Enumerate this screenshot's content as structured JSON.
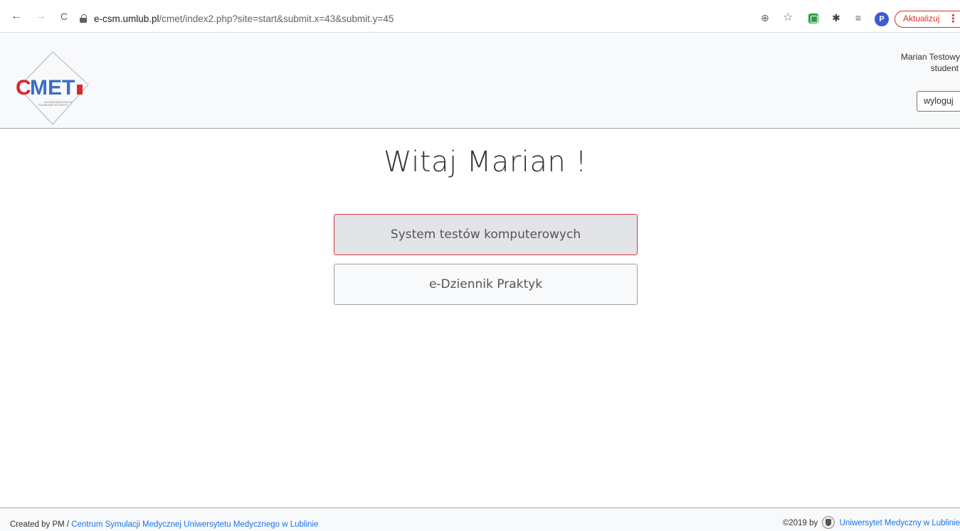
{
  "browser": {
    "back_glyph": "←",
    "forward_glyph": "→",
    "reload_glyph": "C",
    "url_host": "e-csm.umlub.pl",
    "url_path": "/cmet/index2.php?site=start&submit.x=43&submit.y=45",
    "zoom_glyph": "⊕",
    "star_glyph": "☆",
    "puzzle_glyph": "✱",
    "playlist_glyph": "≡",
    "profile_letter": "P",
    "update_label": "Aktualizuj",
    "menu_glyph": "⋮"
  },
  "header": {
    "logo_text": "CMET",
    "logo_subtitle_line1": "CENTRUM MEDYCZNYCH",
    "logo_subtitle_line2": "EGZAMINÓW TESTOWYCH",
    "user_name": "Marian Testowy",
    "user_role": "student",
    "logout_label": "wyloguj"
  },
  "main": {
    "welcome": "Witaj Marian !",
    "buttons": [
      {
        "label": "System testów komputerowych"
      },
      {
        "label": "e-Dziennik Praktyk"
      }
    ]
  },
  "footer": {
    "created_prefix": "Created by PM / ",
    "created_link": "Centrum Symulacji Medycznej Uniwersytetu Medycznego w Lublinie",
    "copyright": "©2019 by",
    "university_link": "Uniwersytet Medyczny w Lublinie"
  },
  "colors": {
    "accent_red": "#d93025",
    "link_blue": "#1a73e8",
    "logo_red": "#d42a2f",
    "logo_blue": "#3a6fc4"
  }
}
